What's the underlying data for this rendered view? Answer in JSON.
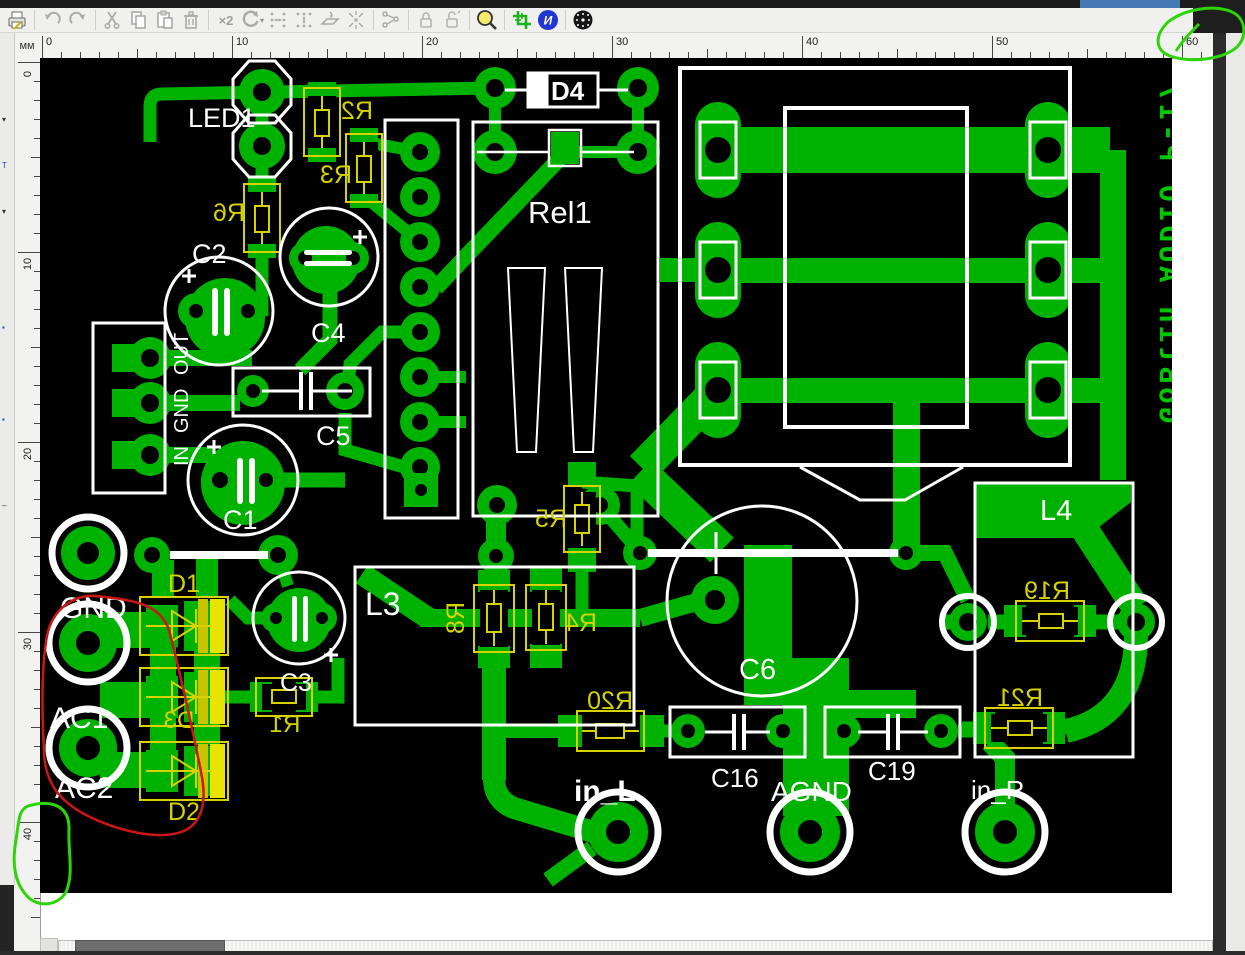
{
  "toolbar": {
    "multiply_label": "×2",
    "language_label": "И",
    "dropdown_caret": "▾"
  },
  "rulers": {
    "unit": "мм",
    "horizontal_labels": [
      "0",
      "10",
      "20",
      "30",
      "40",
      "50",
      "60"
    ],
    "vertical_labels": [
      "0",
      "10",
      "20",
      "30",
      "40"
    ]
  },
  "pcb": {
    "title_vertical": "GoBlin AUDIO P-17",
    "silkscreen": {
      "led1": "LED1",
      "d4": "D4",
      "rel1": "Rel1",
      "c2": "C2",
      "c4": "C4",
      "c5": "C5",
      "c1": "C1",
      "c3": "C3",
      "c6": "C6",
      "c16": "C16",
      "c19": "C19",
      "l3": "L3",
      "l4": "L4",
      "agnd": "AGND",
      "in_l": "in_L",
      "in_r": "in_R",
      "gnd": "GND",
      "ac1": "AC1",
      "ac2": "AC2"
    },
    "regulator_pins": {
      "out": "OUT",
      "gnd": "GND",
      "in": "IN"
    },
    "mirrored_labels": {
      "r1": "R1",
      "r2": "R2",
      "r3": "R3",
      "r4": "R4",
      "r5": "R5",
      "r6": "R6",
      "r8": "R8",
      "r19": "R19",
      "r20": "R20",
      "r21": "R21",
      "d3": "D3"
    },
    "labels": {
      "d1": "D1",
      "d2": "D2"
    },
    "colors": {
      "copper": "#00B200",
      "silkscreen": "#ffffff",
      "smd_outline": "#d6d300",
      "smd_strip": "#e8e400",
      "board": "#000000",
      "title_text": "#00c600",
      "annotation_red": "#cc1616",
      "annotation_green": "#2ed40a"
    }
  }
}
